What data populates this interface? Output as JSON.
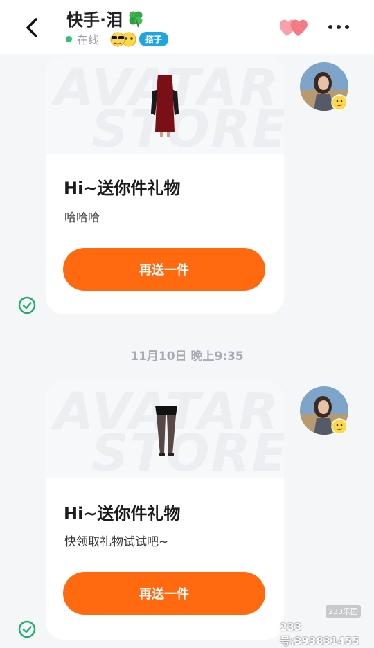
{
  "header": {
    "contact_name": "快手·泪",
    "online_status": "在线",
    "relation_tag": "搭子",
    "icons": {
      "back": "back-arrow-icon",
      "name_emoji": "four-leaf-clover-icon",
      "status_emoji": "sunglasses-emoji-icon",
      "intimacy": "double-heart-icon",
      "more": "more-dots-icon"
    }
  },
  "messages": [
    {
      "image_watermark": [
        "AVATAR",
        "STORE"
      ],
      "item_icon": "red-dress-icon",
      "title": "Hi~送你件礼物",
      "text": "哈哈哈",
      "button_label": "再送一件",
      "status_icon": "read-check-icon"
    },
    {
      "image_watermark": [
        "AVATAR",
        "STORE"
      ],
      "item_icon": "black-stockings-icon",
      "title": "Hi~送你件礼物",
      "text": "快领取礼物试试吧~",
      "button_label": "再送一件",
      "status_icon": "read-check-icon"
    }
  ],
  "timestamp": "11月10日 晚上9:35",
  "watermark": {
    "site_badge": "233乐园",
    "site_id": "233号:393831455"
  },
  "colors": {
    "accent_button": "#ff6a10",
    "online_green": "#2ec26a",
    "check_green": "#1fae6a",
    "tag_blue": "#1fa6e0",
    "heart_pink": "#f47b86"
  }
}
